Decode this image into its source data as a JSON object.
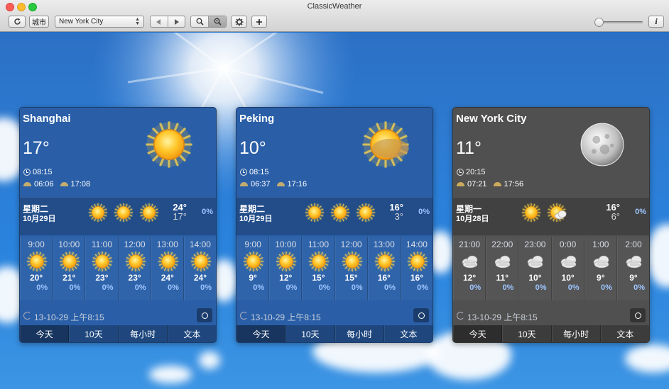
{
  "window": {
    "title": "ClassicWeather"
  },
  "toolbar": {
    "city_label": "城市",
    "city_selected": "New York City",
    "info_label": "i"
  },
  "colors": {
    "day_card": "#2a5fa8",
    "night_card": "#505050",
    "percent_text": "#9dc5ff",
    "sky": "#2a83dd"
  },
  "cards": [
    {
      "city": "Shanghai",
      "temp": "17°",
      "mode": "day",
      "big_icon": "sun-icon",
      "time": "08:15",
      "sunrise": "06:06",
      "sunset": "17:08",
      "day": {
        "name": "星期二",
        "date": "10月29日",
        "icons": [
          "sun-icon",
          "sun-icon",
          "sun-icon"
        ],
        "hi": "24°",
        "lo": "17°",
        "pct": "0%"
      },
      "hours": [
        {
          "time": "9:00",
          "icon": "sun-icon",
          "temp": "20°",
          "pct": "0%"
        },
        {
          "time": "10:00",
          "icon": "sun-icon",
          "temp": "21°",
          "pct": "0%"
        },
        {
          "time": "11:00",
          "icon": "sun-icon",
          "temp": "23°",
          "pct": "0%"
        },
        {
          "time": "12:00",
          "icon": "sun-icon",
          "temp": "23°",
          "pct": "0%"
        },
        {
          "time": "13:00",
          "icon": "sun-icon",
          "temp": "24°",
          "pct": "0%"
        },
        {
          "time": "14:00",
          "icon": "sun-icon",
          "temp": "24°",
          "pct": "0%"
        }
      ],
      "updated": "13-10-29 上午8:15",
      "tabs": [
        "今天",
        "10天",
        "每小时",
        "文本"
      ]
    },
    {
      "city": "Peking",
      "temp": "10°",
      "mode": "day",
      "big_icon": "hazy-sun-icon",
      "time": "08:15",
      "sunrise": "06:37",
      "sunset": "17:16",
      "day": {
        "name": "星期二",
        "date": "10月29日",
        "icons": [
          "sun-icon",
          "sun-icon",
          "sun-icon"
        ],
        "hi": "16°",
        "lo": "3°",
        "pct": "0%"
      },
      "hours": [
        {
          "time": "9:00",
          "icon": "sun-icon",
          "temp": "9°",
          "pct": "0%"
        },
        {
          "time": "10:00",
          "icon": "sun-icon",
          "temp": "12°",
          "pct": "0%"
        },
        {
          "time": "11:00",
          "icon": "sun-icon",
          "temp": "15°",
          "pct": "0%"
        },
        {
          "time": "12:00",
          "icon": "sun-icon",
          "temp": "15°",
          "pct": "0%"
        },
        {
          "time": "13:00",
          "icon": "sun-icon",
          "temp": "16°",
          "pct": "0%"
        },
        {
          "time": "14:00",
          "icon": "sun-icon",
          "temp": "16°",
          "pct": "0%"
        }
      ],
      "updated": "13-10-29 上午8:15",
      "tabs": [
        "今天",
        "10天",
        "每小时",
        "文本"
      ]
    },
    {
      "city": "New York City",
      "temp": "11°",
      "mode": "night",
      "big_icon": "moon-icon",
      "time": "20:15",
      "sunrise": "07:21",
      "sunset": "17:56",
      "day": {
        "name": "星期一",
        "date": "10月28日",
        "icons": [
          "sun-icon",
          "partly-cloudy-icon"
        ],
        "hi": "16°",
        "lo": "6°",
        "pct": "0%"
      },
      "hours": [
        {
          "time": "21:00",
          "icon": "cloudy-night-icon",
          "temp": "12°",
          "pct": "0%"
        },
        {
          "time": "22:00",
          "icon": "cloudy-night-icon",
          "temp": "11°",
          "pct": "0%"
        },
        {
          "time": "23:00",
          "icon": "cloudy-night-icon",
          "temp": "10°",
          "pct": "0%"
        },
        {
          "time": "0:00",
          "icon": "cloudy-night-icon",
          "temp": "10°",
          "pct": "0%"
        },
        {
          "time": "1:00",
          "icon": "cloudy-night-icon",
          "temp": "9°",
          "pct": "0%"
        },
        {
          "time": "2:00",
          "icon": "cloudy-night-icon",
          "temp": "9°",
          "pct": "0%"
        }
      ],
      "updated": "13-10-29 上午8:15",
      "tabs": [
        "今天",
        "10天",
        "每小时",
        "文本"
      ]
    }
  ]
}
